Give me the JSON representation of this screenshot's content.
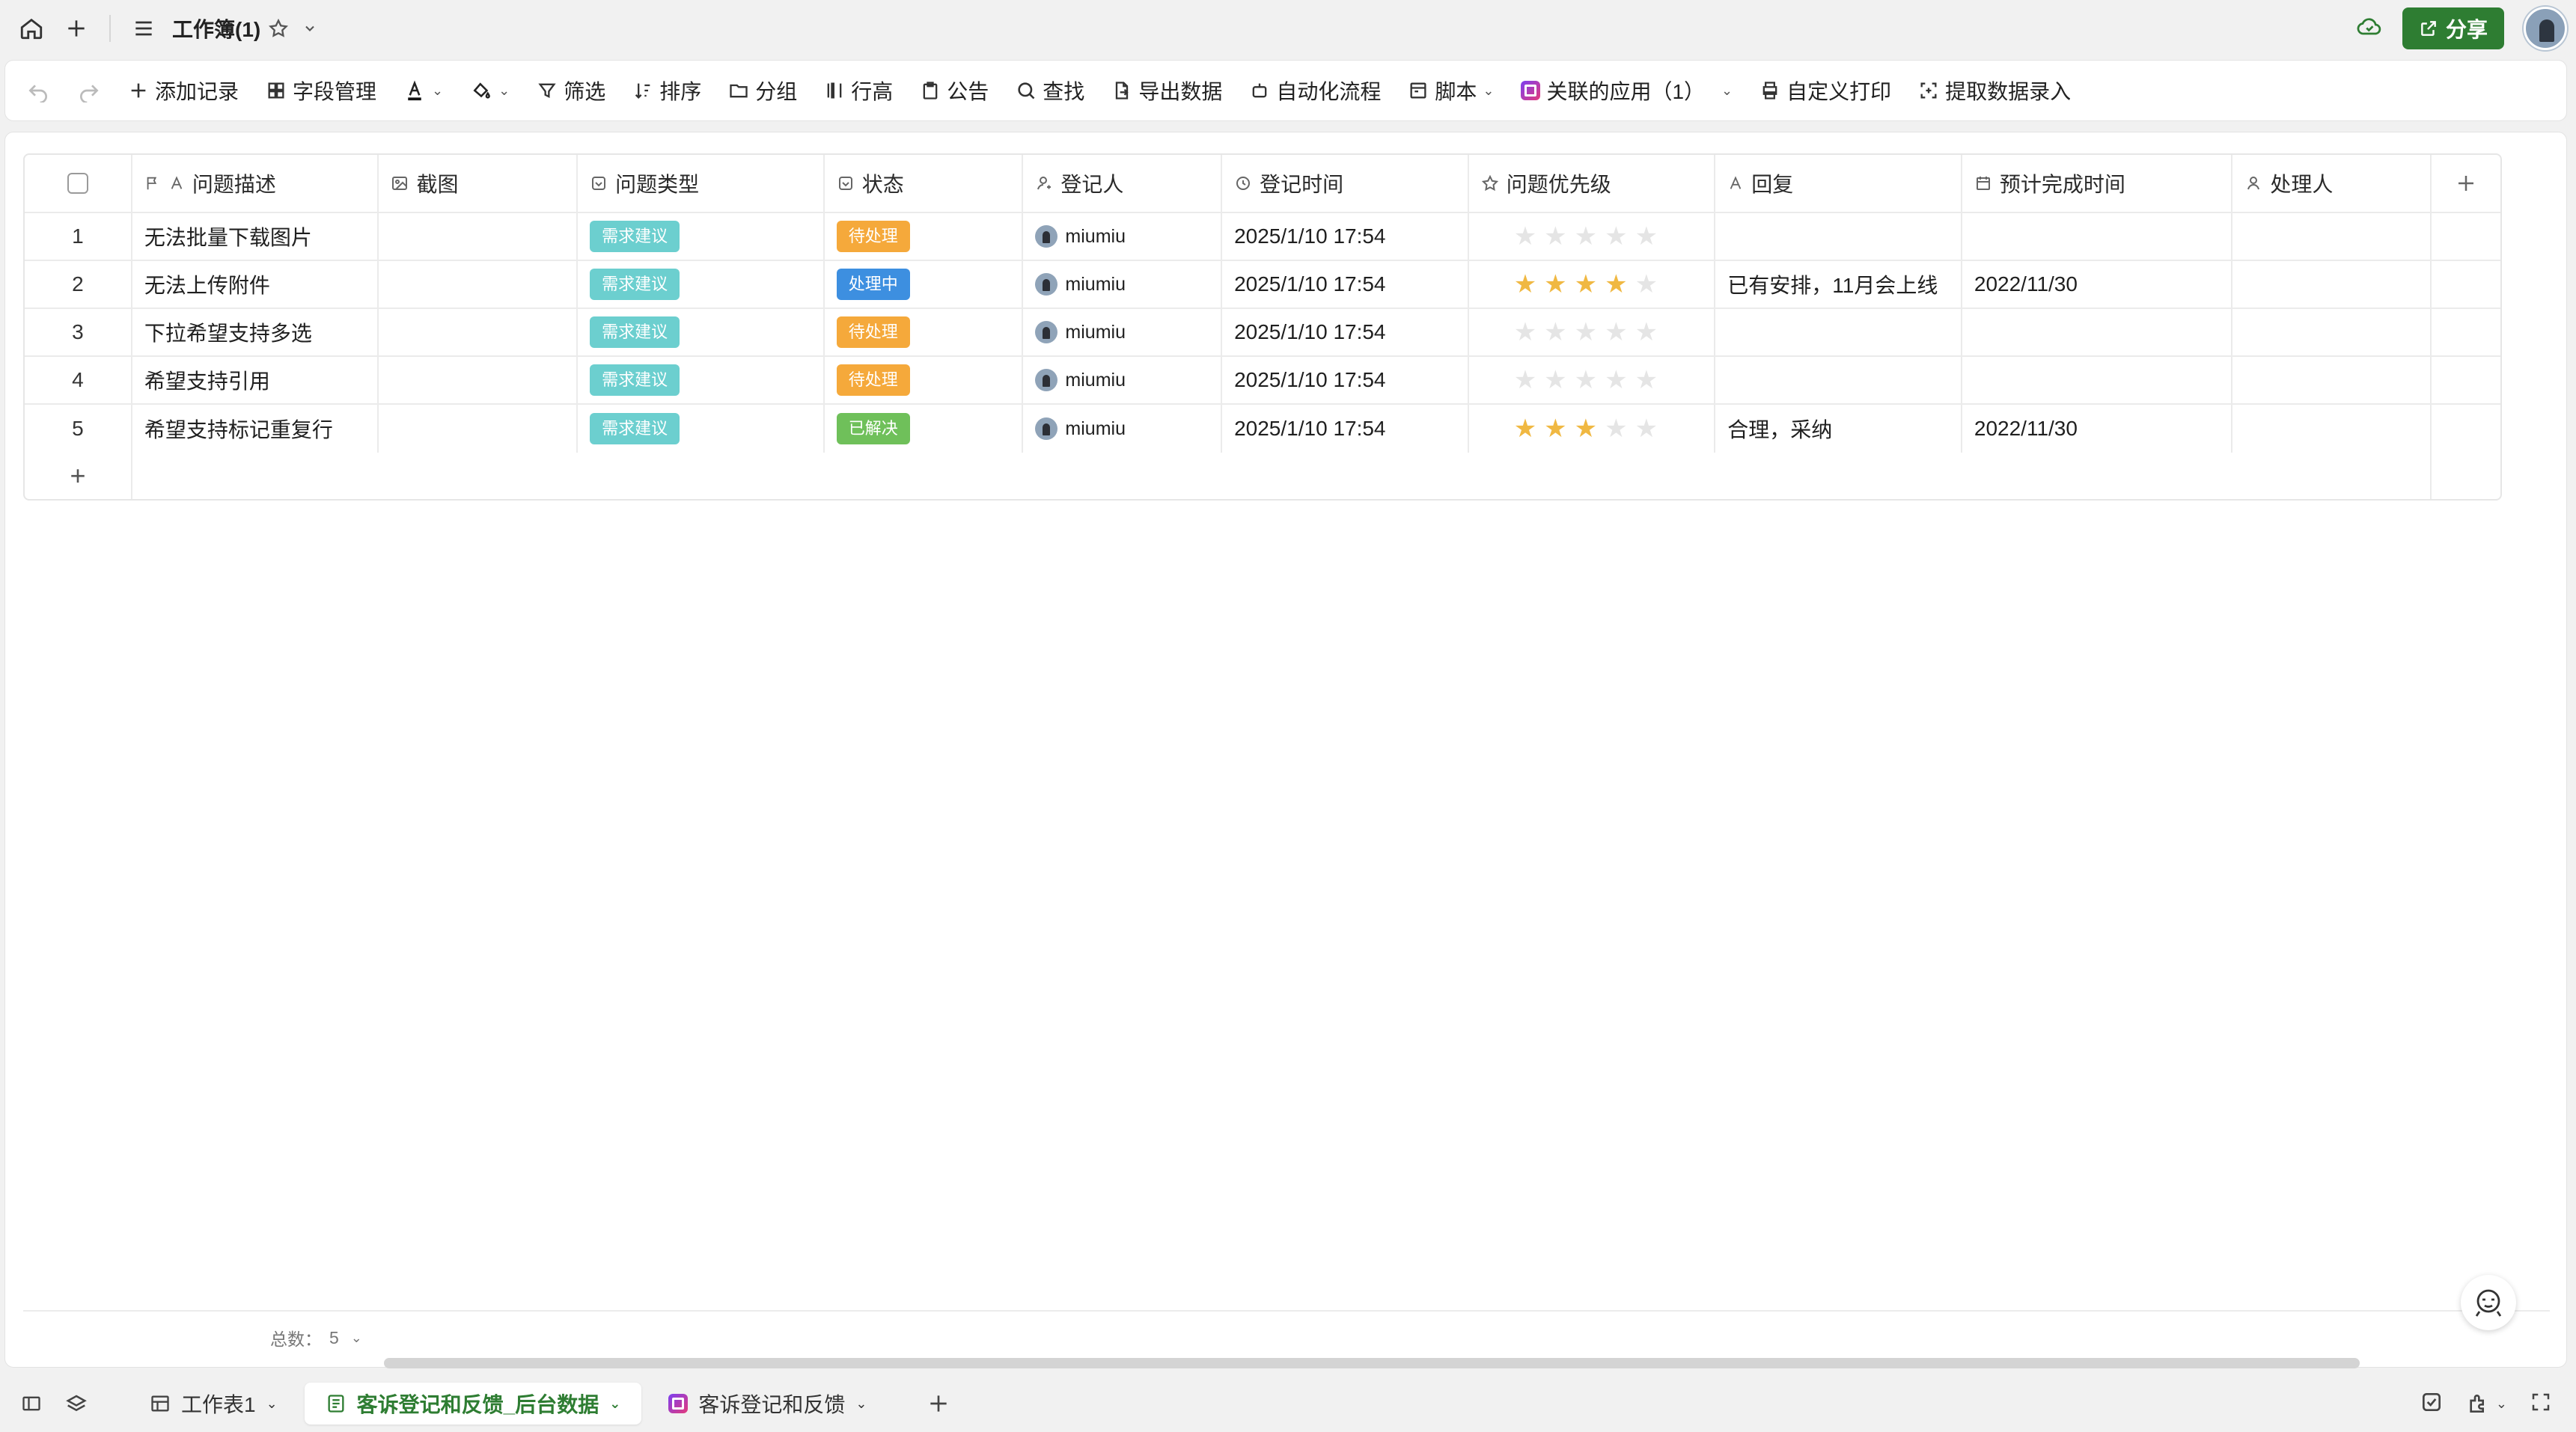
{
  "titlebar": {
    "doc_title": "工作簿(1)",
    "share_label": "分享"
  },
  "toolbar": {
    "add_record": "添加记录",
    "field_manage": "字段管理",
    "filter": "筛选",
    "sort": "排序",
    "group": "分组",
    "row_height": "行高",
    "notice": "公告",
    "find": "查找",
    "export": "导出数据",
    "automation": "自动化流程",
    "script": "脚本",
    "linked_apps": "关联的应用（1）",
    "custom_print": "自定义打印",
    "extract_entry": "提取数据录入"
  },
  "columns": [
    {
      "label": "问题描述",
      "icon": "text-icon"
    },
    {
      "label": "截图",
      "icon": "image-icon"
    },
    {
      "label": "问题类型",
      "icon": "select-icon"
    },
    {
      "label": "状态",
      "icon": "select-icon"
    },
    {
      "label": "登记人",
      "icon": "user-icon"
    },
    {
      "label": "登记时间",
      "icon": "clock-icon"
    },
    {
      "label": "问题优先级",
      "icon": "star-icon"
    },
    {
      "label": "回复",
      "icon": "text-icon"
    },
    {
      "label": "预计完成时间",
      "icon": "calendar-icon"
    },
    {
      "label": "处理人",
      "icon": "user-icon"
    }
  ],
  "rows": [
    {
      "num": "1",
      "desc": "无法批量下载图片",
      "type": "需求建议",
      "status": "待处理",
      "reporter": "miumiu",
      "time": "2025/1/10 17:54",
      "priority": 0,
      "reply": "",
      "due": "",
      "handler": ""
    },
    {
      "num": "2",
      "desc": "无法上传附件",
      "type": "需求建议",
      "status": "处理中",
      "reporter": "miumiu",
      "time": "2025/1/10 17:54",
      "priority": 4,
      "reply": "已有安排，11月会上线",
      "due": "2022/11/30",
      "handler": ""
    },
    {
      "num": "3",
      "desc": "下拉希望支持多选",
      "type": "需求建议",
      "status": "待处理",
      "reporter": "miumiu",
      "time": "2025/1/10 17:54",
      "priority": 0,
      "reply": "",
      "due": "",
      "handler": ""
    },
    {
      "num": "4",
      "desc": "希望支持引用",
      "type": "需求建议",
      "status": "待处理",
      "reporter": "miumiu",
      "time": "2025/1/10 17:54",
      "priority": 0,
      "reply": "",
      "due": "",
      "handler": ""
    },
    {
      "num": "5",
      "desc": "希望支持标记重复行",
      "type": "需求建议",
      "status": "已解决",
      "reporter": "miumiu",
      "time": "2025/1/10 17:54",
      "priority": 3,
      "reply": "合理，采纳",
      "due": "2022/11/30",
      "handler": ""
    }
  ],
  "priority_max": 5,
  "tag_colors": {
    "需求建议": "#6ccfcf",
    "待处理": "#f5a93b",
    "处理中": "#3d8fe0",
    "已解决": "#6fc05a"
  },
  "footer": {
    "count_label": "总数：",
    "count_value": "5"
  },
  "tabs": [
    {
      "label": "工作表1",
      "active": false
    },
    {
      "label": "客诉登记和反馈_后台数据",
      "active": true
    },
    {
      "label": "客诉登记和反馈",
      "active": false
    }
  ]
}
